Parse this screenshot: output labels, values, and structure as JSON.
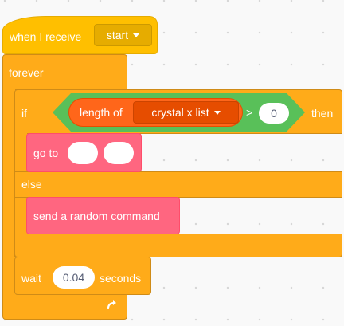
{
  "event_block": {
    "label": "when I receive",
    "message_dropdown": "start"
  },
  "forever_block": {
    "label": "forever"
  },
  "if_else_block": {
    "if_label": "if",
    "then_label": "then",
    "else_label": "else",
    "condition": {
      "length_label": "length of",
      "list_dropdown": "crystal x list",
      "operator": ">",
      "compare_value": "0"
    }
  },
  "goto_block": {
    "label": "go to",
    "input_1": "",
    "input_2": ""
  },
  "send_command_block": {
    "label": "send a random command"
  },
  "wait_block": {
    "label": "wait",
    "value": "0.04",
    "unit_label": "seconds"
  },
  "loop_arrow_icon": "rotate-arrow-icon",
  "colors": {
    "events": "#ffbf00",
    "control": "#ffab19",
    "operators": "#59c059",
    "list": "#ff661a",
    "custom": "#ff6680"
  }
}
